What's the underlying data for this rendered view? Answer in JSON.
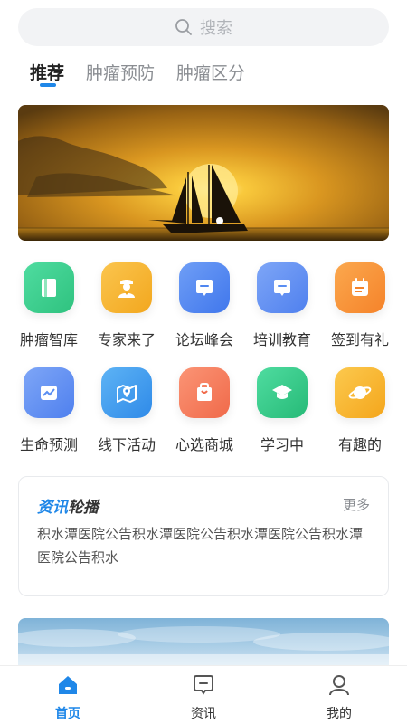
{
  "search": {
    "placeholder": "搜索"
  },
  "tabs": [
    {
      "label": "推荐",
      "active": true
    },
    {
      "label": "肿瘤预防",
      "active": false
    },
    {
      "label": "肿瘤区分",
      "active": false
    }
  ],
  "banner": {
    "image": "sailboat-sunset",
    "slides": 1,
    "active_slide": 1
  },
  "grid": {
    "row1": [
      {
        "label": "肿瘤智库",
        "icon": "book-icon",
        "color": "#3ccf8e"
      },
      {
        "label": "专家来了",
        "icon": "doctor-icon",
        "color": "#f5b332"
      },
      {
        "label": "论坛峰会",
        "icon": "forum-chat-icon",
        "color": "#4f86f0"
      },
      {
        "label": "培训教育",
        "icon": "training-chat-icon",
        "color": "#5a8ef2"
      },
      {
        "label": "签到有礼",
        "icon": "sign-in-calendar-icon",
        "color": "#f7913a"
      }
    ],
    "row2": [
      {
        "label": "生命预测",
        "icon": "trend-chart-icon",
        "color": "#5a8ef2"
      },
      {
        "label": "线下活动",
        "icon": "map-location-icon",
        "color": "#3e9ef0"
      },
      {
        "label": "心选商城",
        "icon": "shopping-bag-icon",
        "color": "#f57c5e"
      },
      {
        "label": "学习中",
        "icon": "graduation-cap-icon",
        "color": "#35c98a"
      },
      {
        "label": "有趣的",
        "icon": "planet-icon",
        "color": "#f7b731"
      }
    ]
  },
  "news": {
    "logo_part1": "资讯",
    "logo_part2": "轮播",
    "more": "更多",
    "text": "积水潭医院公告积水潭医院公告积水潭医院公告积水潭医院公告积水"
  },
  "tabbar": [
    {
      "label": "首页",
      "icon": "home-icon",
      "active": true
    },
    {
      "label": "资讯",
      "icon": "message-icon",
      "active": false
    },
    {
      "label": "我的",
      "icon": "profile-icon",
      "active": false
    }
  ],
  "colors": {
    "accent": "#1f87e8",
    "search_bg": "#f2f3f5"
  }
}
